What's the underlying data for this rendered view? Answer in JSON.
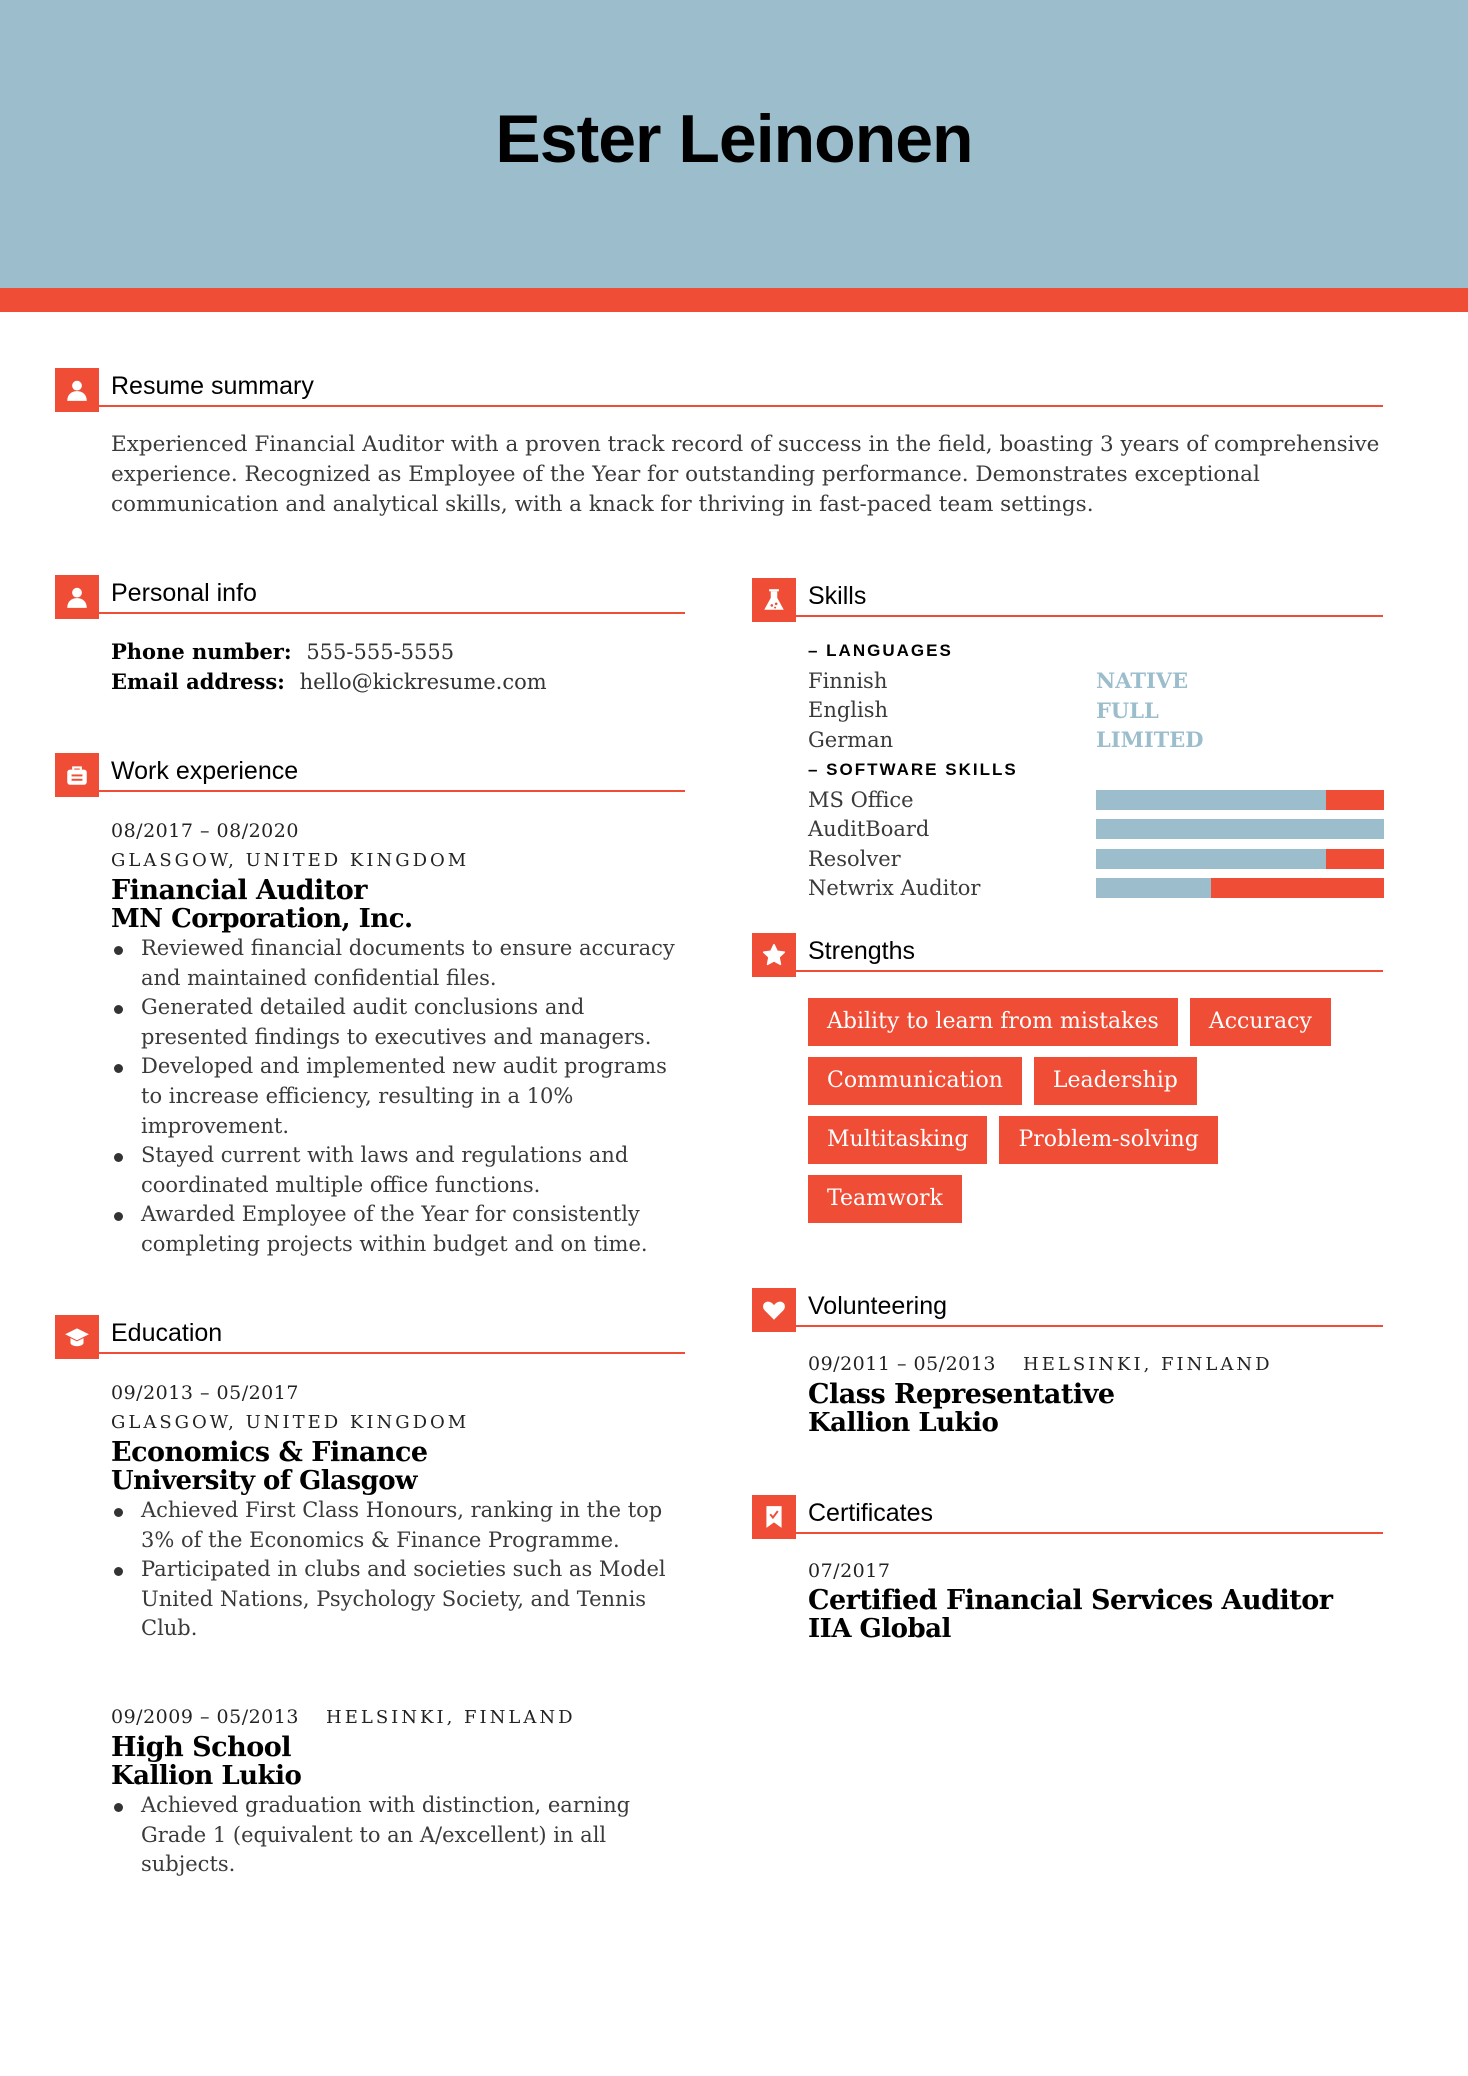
{
  "header": {
    "name": "Ester Leinonen"
  },
  "colors": {
    "accent": "#ef4d35",
    "header_bg": "#9bbdcc",
    "level_text": "#9bbdcc"
  },
  "summary": {
    "title": "Resume summary",
    "icon": "user-icon",
    "text": "Experienced Financial Auditor with a proven track record of success in the field, boasting 3 years of comprehensive experience. Recognized as Employee of the Year for outstanding performance. Demonstrates exceptional communication and analytical skills, with a knack for thriving in fast-paced team settings."
  },
  "personal": {
    "title": "Personal info",
    "icon": "user-icon",
    "phone_label": "Phone number:",
    "phone": "555-555-5555",
    "email_label": "Email address:",
    "email": "hello@kickresume.com"
  },
  "work": {
    "title": "Work experience",
    "icon": "briefcase-icon",
    "jobs": [
      {
        "dates": "08/2017 – 08/2020",
        "location": "GLASGOW, UNITED KINGDOM",
        "role": "Financial Auditor",
        "company": "MN Corporation, Inc.",
        "bullets": [
          "Reviewed financial documents to ensure accuracy and maintained confidential files.",
          "Generated detailed audit conclusions and presented findings to executives and managers.",
          "Developed and implemented new audit programs to increase efficiency, resulting in a 10% improvement.",
          "Stayed current with laws and regulations and coordinated multiple office functions.",
          "Awarded Employee of the Year for consistently completing projects within budget and on time."
        ]
      }
    ]
  },
  "education": {
    "title": "Education",
    "icon": "graduation-cap-icon",
    "items": [
      {
        "dates": "09/2013 – 05/2017",
        "location": "GLASGOW, UNITED KINGDOM",
        "degree": "Economics & Finance",
        "school": "University of Glasgow",
        "bullets": [
          "Achieved First Class Honours, ranking in the top 3% of the Economics & Finance Programme.",
          "Participated in clubs and societies such as Model United Nations, Psychology Society, and Tennis Club."
        ]
      },
      {
        "dates": "09/2009 – 05/2013",
        "location": "HELSINKI, FINLAND",
        "degree": "High School",
        "school": "Kallion Lukio",
        "bullets": [
          "Achieved graduation with distinction, earning Grade 1 (equivalent to an A/excellent) in all subjects."
        ]
      }
    ]
  },
  "skills": {
    "title": "Skills",
    "icon": "flask-icon",
    "languages_label": "– LANGUAGES",
    "languages": [
      {
        "name": "Finnish",
        "level": "NATIVE"
      },
      {
        "name": "English",
        "level": "FULL"
      },
      {
        "name": "German",
        "level": "LIMITED"
      }
    ],
    "software_label": "– SOFTWARE SKILLS",
    "software": [
      {
        "name": "MS Office",
        "level": 0.8
      },
      {
        "name": "AuditBoard",
        "level": 1.0
      },
      {
        "name": "Resolver",
        "level": 0.8
      },
      {
        "name": "Netwrix Auditor",
        "level": 0.4
      }
    ]
  },
  "strengths": {
    "title": "Strengths",
    "icon": "star-icon",
    "items": [
      "Ability to learn from mistakes",
      "Accuracy",
      "Communication",
      "Leadership",
      "Multitasking",
      "Problem-solving",
      "Teamwork"
    ]
  },
  "volunteering": {
    "title": "Volunteering",
    "icon": "heart-icon",
    "dates": "09/2011 – 05/2013",
    "location": "HELSINKI, FINLAND",
    "role": "Class Representative",
    "org": "Kallion Lukio"
  },
  "certificates": {
    "title": "Certificates",
    "icon": "certificate-icon",
    "date": "07/2017",
    "name": "Certified Financial Services Auditor",
    "issuer": "IIA Global"
  }
}
